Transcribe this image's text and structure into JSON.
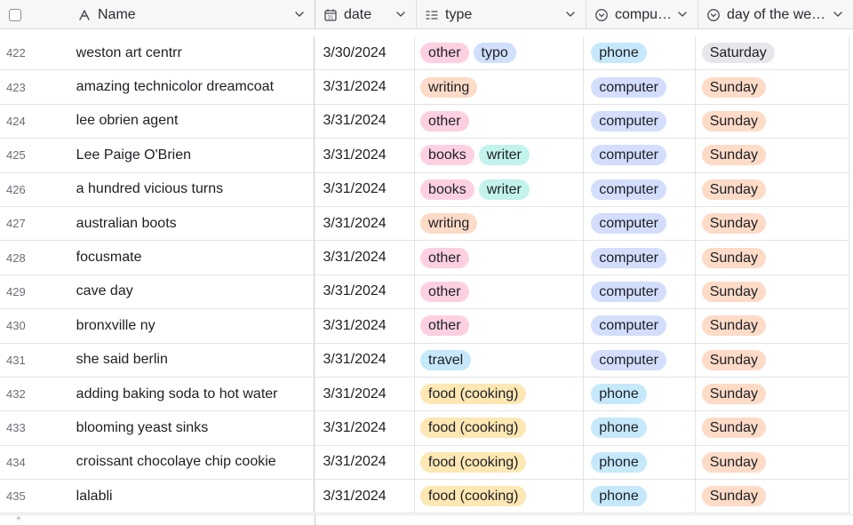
{
  "columns": {
    "name": "Name",
    "date": "date",
    "type": "type",
    "computer": "compu…",
    "day": "day of the we…"
  },
  "colors": {
    "other": "#fdd0e1",
    "typo": "#cfdffc",
    "writing": "#fddbc7",
    "books": "#fdd0e1",
    "writer": "#c2f3ec",
    "travel": "#c6e8fb",
    "food (cooking)": "#fde7b3",
    "phone": "#c6e8fb",
    "computer": "#d2defc",
    "Saturday": "#e6e7ea",
    "Sunday": "#fddbc7"
  },
  "rows": [
    {
      "num": "422",
      "name": "weston art centrr",
      "date": "3/30/2024",
      "types": [
        "other",
        "typo"
      ],
      "computer": "phone",
      "day": "Saturday"
    },
    {
      "num": "423",
      "name": "amazing technicolor dreamcoat",
      "date": "3/31/2024",
      "types": [
        "writing"
      ],
      "computer": "computer",
      "day": "Sunday"
    },
    {
      "num": "424",
      "name": "lee obrien agent",
      "date": "3/31/2024",
      "types": [
        "other"
      ],
      "computer": "computer",
      "day": "Sunday"
    },
    {
      "num": "425",
      "name": "Lee Paige O'Brien",
      "date": "3/31/2024",
      "types": [
        "books",
        "writer"
      ],
      "computer": "computer",
      "day": "Sunday"
    },
    {
      "num": "426",
      "name": "a hundred vicious turns",
      "date": "3/31/2024",
      "types": [
        "books",
        "writer"
      ],
      "computer": "computer",
      "day": "Sunday"
    },
    {
      "num": "427",
      "name": "australian boots",
      "date": "3/31/2024",
      "types": [
        "writing"
      ],
      "computer": "computer",
      "day": "Sunday"
    },
    {
      "num": "428",
      "name": "focusmate",
      "date": "3/31/2024",
      "types": [
        "other"
      ],
      "computer": "computer",
      "day": "Sunday"
    },
    {
      "num": "429",
      "name": "cave day",
      "date": "3/31/2024",
      "types": [
        "other"
      ],
      "computer": "computer",
      "day": "Sunday"
    },
    {
      "num": "430",
      "name": "bronxville ny",
      "date": "3/31/2024",
      "types": [
        "other"
      ],
      "computer": "computer",
      "day": "Sunday"
    },
    {
      "num": "431",
      "name": "she said berlin",
      "date": "3/31/2024",
      "types": [
        "travel"
      ],
      "computer": "computer",
      "day": "Sunday"
    },
    {
      "num": "432",
      "name": "adding baking soda to hot water",
      "date": "3/31/2024",
      "types": [
        "food (cooking)"
      ],
      "computer": "phone",
      "day": "Sunday"
    },
    {
      "num": "433",
      "name": "blooming yeast sinks",
      "date": "3/31/2024",
      "types": [
        "food (cooking)"
      ],
      "computer": "phone",
      "day": "Sunday"
    },
    {
      "num": "434",
      "name": "croissant chocolaye chip cookie",
      "date": "3/31/2024",
      "types": [
        "food (cooking)"
      ],
      "computer": "phone",
      "day": "Sunday"
    },
    {
      "num": "435",
      "name": "lalabli",
      "date": "3/31/2024",
      "types": [
        "food (cooking)"
      ],
      "computer": "phone",
      "day": "Sunday"
    }
  ]
}
